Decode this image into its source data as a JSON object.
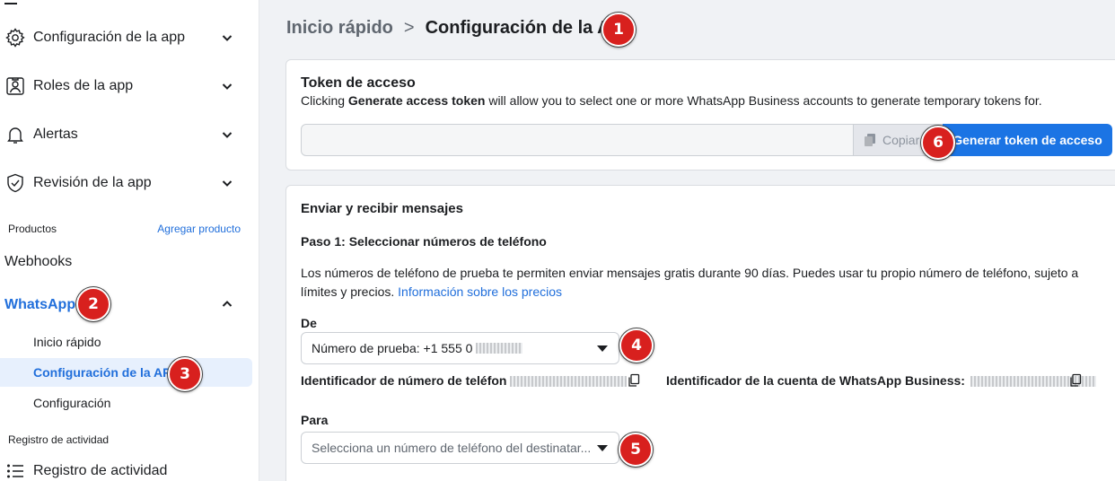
{
  "sidebar": {
    "items": [
      {
        "label": "Configuración de la app",
        "icon": "gear-icon"
      },
      {
        "label": "Roles de la app",
        "icon": "user-badge-icon"
      },
      {
        "label": "Alertas",
        "icon": "bell-icon"
      },
      {
        "label": "Revisión de la app",
        "icon": "shield-check-icon"
      }
    ],
    "products_label": "Productos",
    "add_product_label": "Agregar producto",
    "webhooks_label": "Webhooks",
    "whatsapp_label": "WhatsApp",
    "whatsapp_sub": [
      "Inicio rápido",
      "Configuración de la API",
      "Configuración"
    ],
    "activity_section_label": "Registro de actividad",
    "activity_item_label": "Registro de actividad"
  },
  "breadcrumb": {
    "first": "Inicio rápido",
    "separator": ">",
    "current": "Configuración de la API"
  },
  "token_card": {
    "title": "Token de acceso",
    "desc_prefix": "Clicking ",
    "desc_bold": "Generate access token",
    "desc_suffix": " will allow you to select one or more WhatsApp Business accounts to generate temporary tokens for.",
    "copy_label": "Copiar",
    "generate_label": "Generar token de acceso"
  },
  "messages_card": {
    "title": "Enviar y recibir mensajes",
    "step_title": "Paso 1: Seleccionar números de teléfono",
    "desc_line1": "Los números de teléfono de prueba te permiten enviar mensajes gratis durante 90 días. Puedes usar tu propio número de teléfono, sujeto a",
    "desc_line2": "límites y precios. ",
    "pricing_link": "Información sobre los precios",
    "from_label": "De",
    "from_value": "Número de prueba: +1 555 0",
    "phone_id_label": "Identificador de número de teléfon",
    "waba_id_label": "Identificador de la cuenta de WhatsApp Business:",
    "to_label": "Para",
    "to_placeholder": "Selecciona un número de teléfono del destinatar..."
  },
  "markers": [
    "1",
    "2",
    "3",
    "4",
    "5",
    "6"
  ],
  "colors": {
    "accent": "#1b74e4",
    "link": "#216fdb",
    "marker": "#d8201e"
  }
}
